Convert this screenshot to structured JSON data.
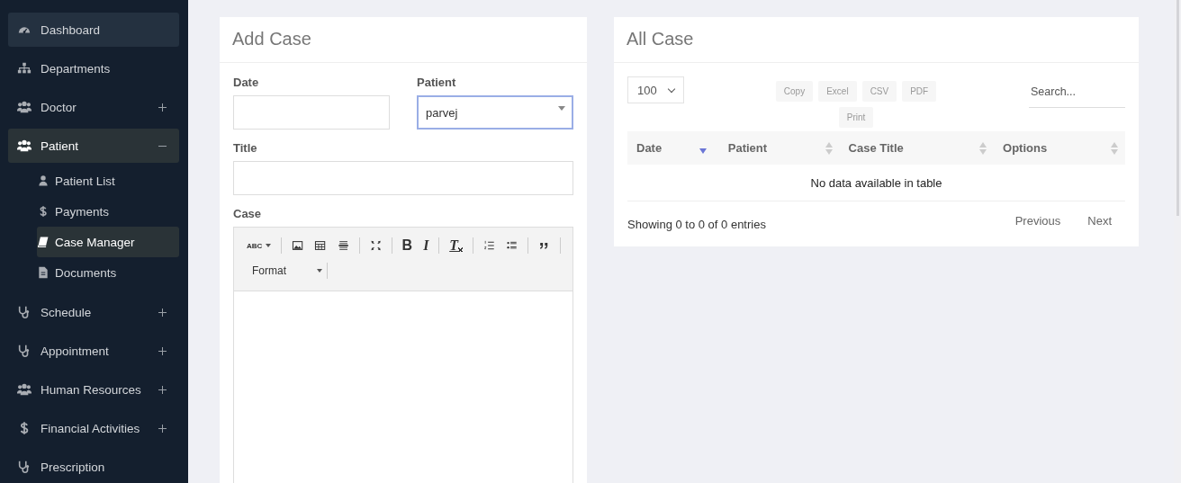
{
  "sidebar": {
    "items": [
      {
        "label": "Dashboard",
        "hovered": true,
        "selected": false
      },
      {
        "label": "Departments",
        "hovered": false,
        "selected": false
      },
      {
        "label": "Doctor",
        "hovered": false,
        "selected": false,
        "expanded": false
      },
      {
        "label": "Patient",
        "hovered": false,
        "selected": true,
        "expanded": true,
        "children": [
          {
            "label": "Patient List",
            "selected": false
          },
          {
            "label": "Payments",
            "selected": false
          },
          {
            "label": "Case Manager",
            "selected": true
          },
          {
            "label": "Documents",
            "selected": false
          }
        ]
      },
      {
        "label": "Schedule",
        "hovered": false,
        "selected": false,
        "expanded": false
      },
      {
        "label": "Appointment",
        "hovered": false,
        "selected": false,
        "expanded": false
      },
      {
        "label": "Human Resources",
        "hovered": false,
        "selected": false,
        "expanded": false
      },
      {
        "label": "Financial Activities",
        "hovered": false,
        "selected": false,
        "expanded": false
      },
      {
        "label": "Prescription",
        "hovered": false,
        "selected": false
      }
    ]
  },
  "add_case": {
    "title": "Add Case",
    "fields": [
      {
        "label": "Date",
        "kind": "text",
        "focused": false
      },
      {
        "label": "Patient",
        "kind": "select",
        "value": "parvej",
        "focused": true
      }
    ],
    "title_field": {
      "label": "Title"
    },
    "case_editor": {
      "label": "Case",
      "toolbar": [
        {
          "kind": "spellcheck",
          "label": "ABC"
        },
        {
          "kind": "sep"
        },
        {
          "kind": "image"
        },
        {
          "kind": "table"
        },
        {
          "kind": "hline"
        },
        {
          "kind": "sep"
        },
        {
          "kind": "maximize"
        },
        {
          "kind": "sep"
        },
        {
          "kind": "bold",
          "label": "B"
        },
        {
          "kind": "italic",
          "label": "I"
        },
        {
          "kind": "sep"
        },
        {
          "kind": "clearformat",
          "label": "T"
        },
        {
          "kind": "sep"
        },
        {
          "kind": "numlist"
        },
        {
          "kind": "bullist"
        },
        {
          "kind": "sep"
        },
        {
          "kind": "quote"
        },
        {
          "kind": "sep"
        }
      ],
      "format": "Format"
    }
  },
  "all_case": {
    "title": "All Case",
    "page_length": "100",
    "export_buttons": [
      "Copy",
      "Excel",
      "CSV",
      "PDF",
      "Print"
    ],
    "search": {
      "placeholder": "Search..."
    },
    "table": {
      "columns": [
        {
          "label": "Date",
          "sorted": true
        },
        {
          "label": "Patient",
          "sorted": false
        },
        {
          "label": "Case Title",
          "sorted": false
        },
        {
          "label": "Options",
          "sorted": false
        }
      ],
      "empty_message": "No data available in table"
    },
    "info": "Showing 0 to 0 of 0 entries",
    "pagination": [
      "Previous",
      "Next"
    ]
  }
}
